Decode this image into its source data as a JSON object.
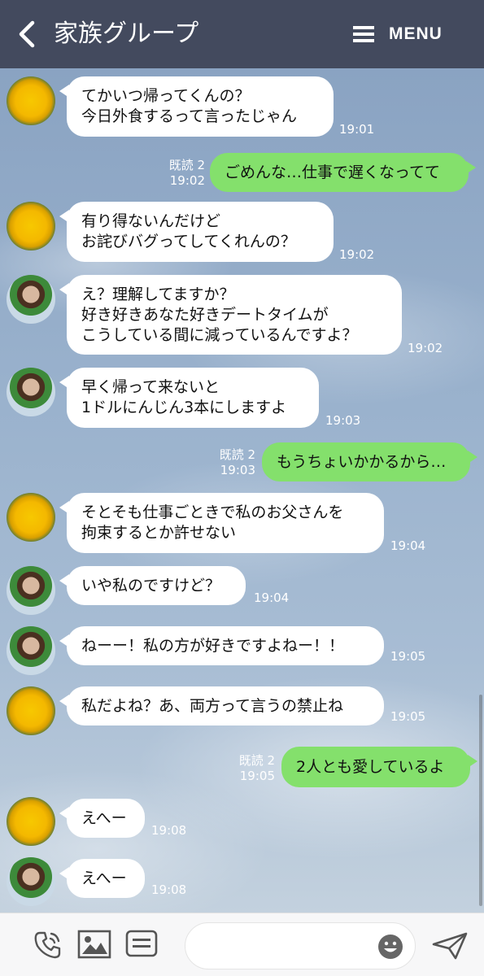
{
  "header": {
    "title": "家族グループ",
    "menu_label": "MENU"
  },
  "messages": [
    {
      "side": "in",
      "avatar": "dandelion",
      "lines": [
        "てかいつ帰ってくんの？",
        "今日外食するって言ったじゃん"
      ],
      "time": "19:01"
    },
    {
      "side": "out",
      "lines": [
        "ごめんな…仕事で遅くなってて"
      ],
      "read": "既読 2",
      "time": "19:02"
    },
    {
      "side": "in",
      "avatar": "dandelion",
      "lines": [
        "有り得ないんだけど",
        "お詫びバグってしてくれんの？"
      ],
      "time": "19:02"
    },
    {
      "side": "in",
      "avatar": "green-hat-girl",
      "lines": [
        "え？理解してますか？",
        "好き好きあなた好きデートタイムが",
        "こうしている間に減っているんですよ？"
      ],
      "time": "19:02"
    },
    {
      "side": "in",
      "avatar": "green-hat-girl",
      "lines": [
        "早く帰って来ないと",
        "1ドルにんじん3本にしますよ"
      ],
      "time": "19:03"
    },
    {
      "side": "out",
      "lines": [
        "もうちょいかかるから…"
      ],
      "read": "既読 2",
      "time": "19:03"
    },
    {
      "side": "in",
      "avatar": "dandelion",
      "lines": [
        "そとそも仕事ごときで私のお父さんを",
        "拘束するとか許せない"
      ],
      "time": "19:04"
    },
    {
      "side": "in",
      "avatar": "green-hat-girl",
      "lines": [
        "いや私のですけど？"
      ],
      "time": "19:04"
    },
    {
      "side": "in",
      "avatar": "green-hat-girl",
      "lines": [
        "ねーー！私の方が好きですよねー！！"
      ],
      "time": "19:05"
    },
    {
      "side": "in",
      "avatar": "dandelion",
      "lines": [
        "私だよね？あ、両方って言うの禁止ね"
      ],
      "time": "19:05"
    },
    {
      "side": "out",
      "lines": [
        "2人とも愛しているよ"
      ],
      "read": "既読 2",
      "time": "19:05"
    },
    {
      "side": "in",
      "avatar": "dandelion",
      "lines": [
        "えへー"
      ],
      "time": "19:08"
    },
    {
      "side": "in",
      "avatar": "green-hat-girl",
      "lines": [
        "えへー"
      ],
      "time": "19:08"
    }
  ],
  "bottom_bar": {
    "icons": [
      "phone-icon",
      "image-icon",
      "keyboard-icon",
      "emoji-icon",
      "send-icon"
    ],
    "input_value": ""
  },
  "colors": {
    "header_bg": "#434a5e",
    "incoming_bubble": "#ffffff",
    "outgoing_bubble": "#84e06c"
  }
}
